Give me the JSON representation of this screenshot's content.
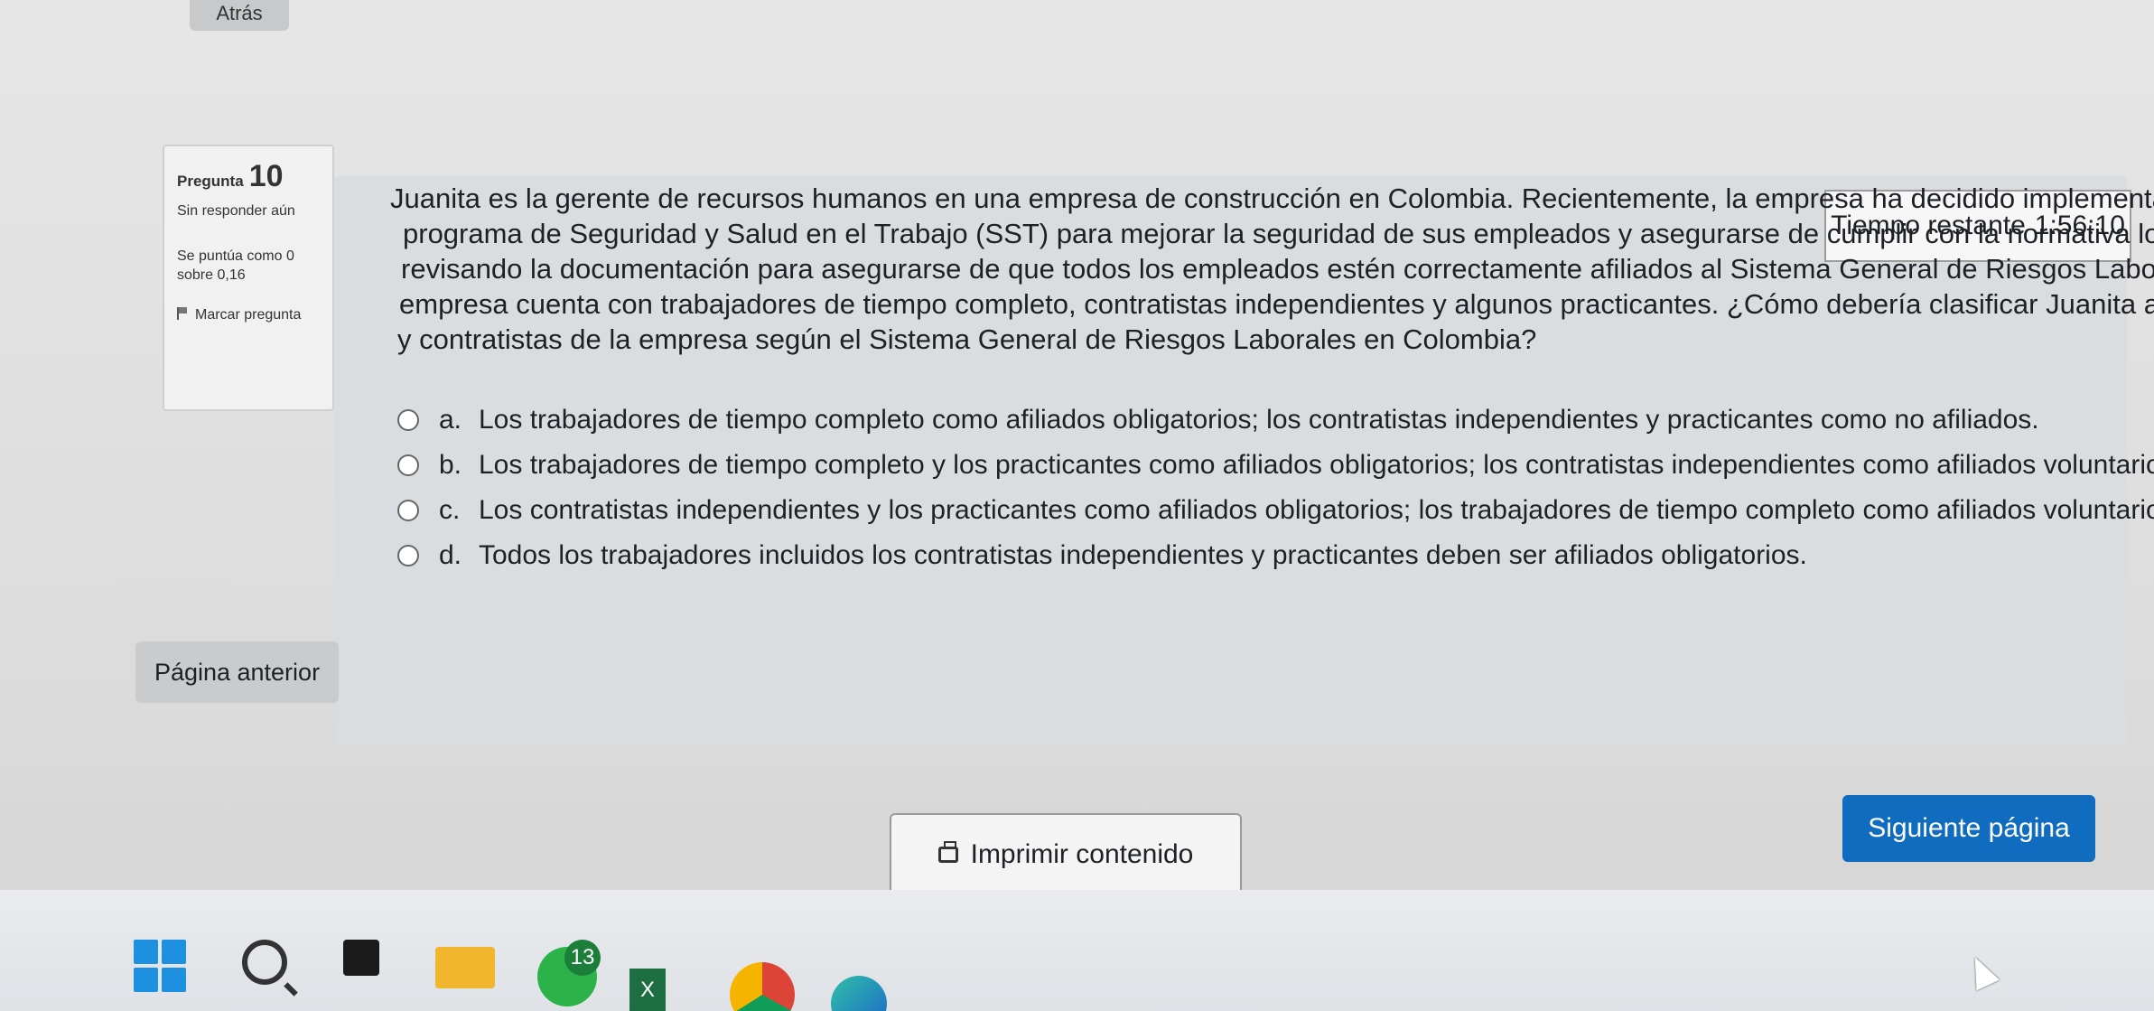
{
  "nav": {
    "back_label": "Atrás"
  },
  "question_info": {
    "label": "Pregunta",
    "number": "10",
    "status": "Sin responder aún",
    "grade": "Se puntúa como 0 sobre 0,16",
    "flag_label": "Marcar pregunta"
  },
  "timer": {
    "label": "Tiempo restante",
    "value": "1:56:10"
  },
  "question": {
    "lines": [
      "Juanita es la gerente de recursos humanos en una empresa de construcción en Colombia. Recientemente, la empresa ha decidido implementar un",
      "programa de Seguridad y Salud en el Trabajo (SST) para mejorar la seguridad de sus empleados y asegurarse de cumplir con la normativa local. Juanita está",
      "revisando la documentación para asegurarse de que todos los empleados estén correctamente afiliados al Sistema General de Riesgos Laborales. La",
      "empresa cuenta con trabajadores de tiempo completo, contratistas independientes y algunos practicantes. ¿Cómo debería clasificar Juanita a los empleados",
      "y contratistas de la empresa según el Sistema General de Riesgos Laborales en Colombia?"
    ]
  },
  "answers": [
    {
      "letter": "a.",
      "text": "Los trabajadores de tiempo completo como afiliados obligatorios; los contratistas independientes y practicantes como no afiliados."
    },
    {
      "letter": "b.",
      "text": "Los trabajadores de tiempo completo y los practicantes como afiliados obligatorios; los contratistas independientes como afiliados voluntarios."
    },
    {
      "letter": "c.",
      "text": "Los contratistas independientes y los practicantes como afiliados obligatorios; los trabajadores de tiempo completo como afiliados voluntarios."
    },
    {
      "letter": "d.",
      "text": "Todos los trabajadores incluidos los contratistas independientes y practicantes deben ser afiliados obligatorios."
    }
  ],
  "footer": {
    "prev_label": "Página anterior",
    "next_label": "Siguiente página",
    "print_label": "Imprimir contenido"
  },
  "taskbar": {
    "whatsapp_badge": "13",
    "excel_letter": "X"
  },
  "colors": {
    "primary": "#0f6cbf",
    "panel": "#d9dde0"
  }
}
